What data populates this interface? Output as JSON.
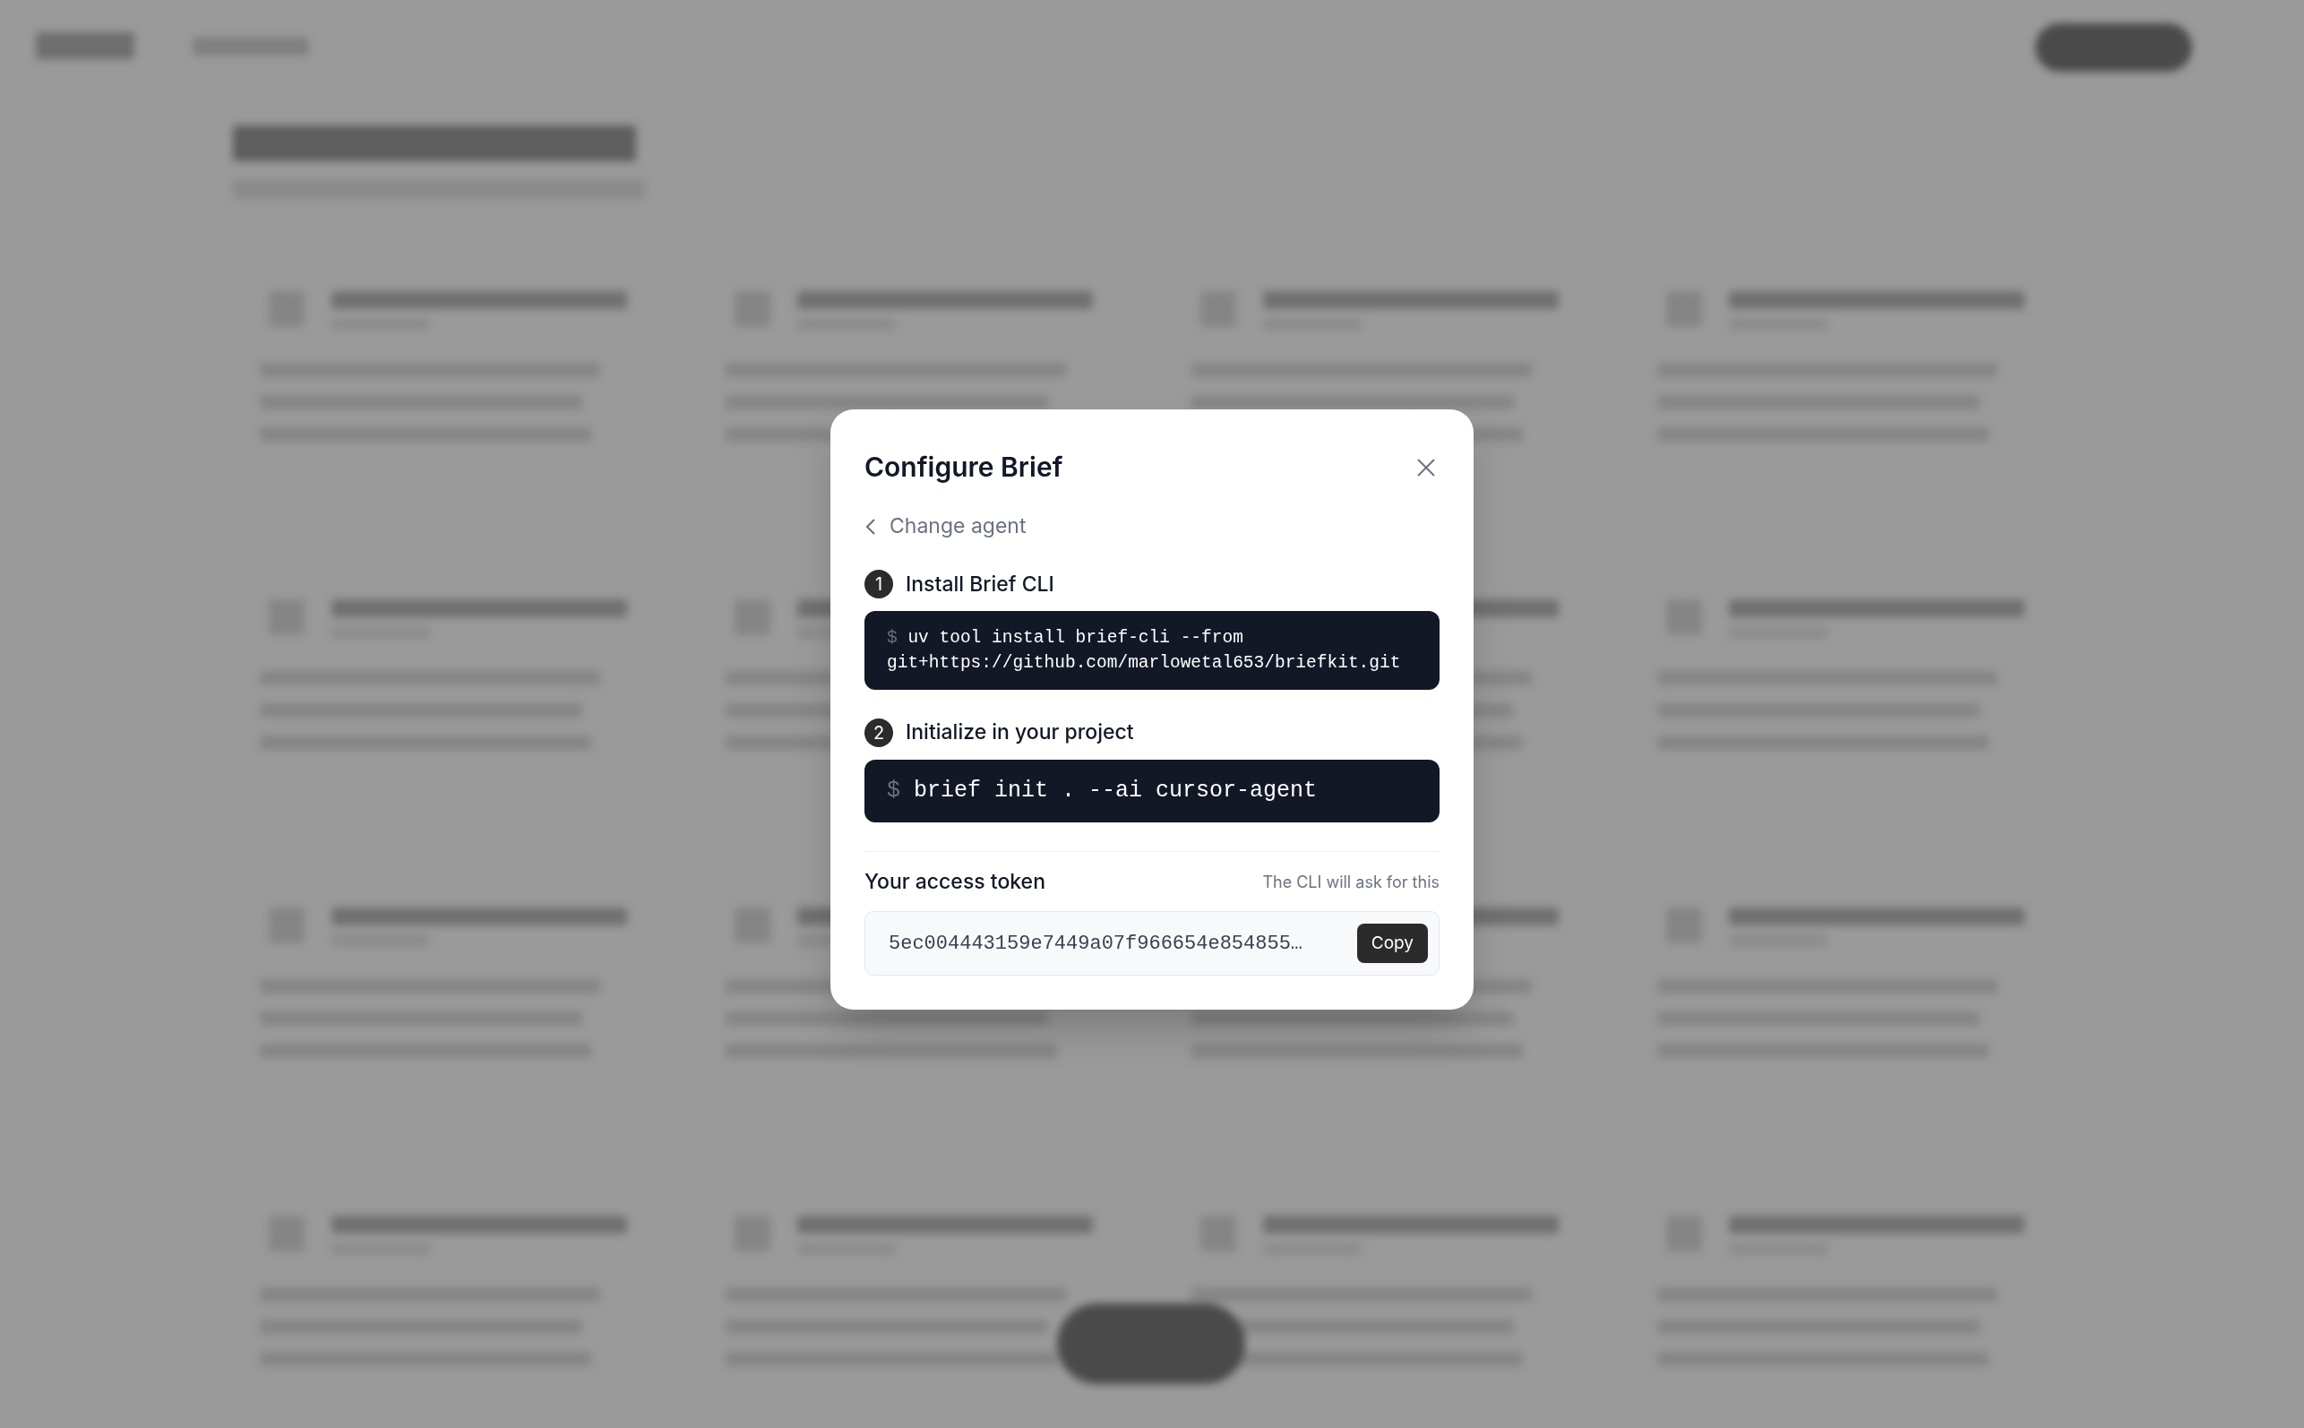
{
  "dialog": {
    "title": "Configure Brief",
    "back_link": "Change agent",
    "steps": [
      {
        "number": "1",
        "title": "Install Brief CLI",
        "prompt": "$",
        "command_lines": [
          "uv tool install brief-cli --from",
          "git+https://github.com/marlowetal653/briefkit.git"
        ]
      },
      {
        "number": "2",
        "title": "Initialize in your project",
        "prompt": "$",
        "command_lines": [
          "brief init . --ai cursor-agent"
        ]
      }
    ],
    "token": {
      "label": "Your access token",
      "hint": "The CLI will ask for this",
      "value": "5ec004443159e7449a07f966654e854855…",
      "button": "Copy"
    }
  }
}
